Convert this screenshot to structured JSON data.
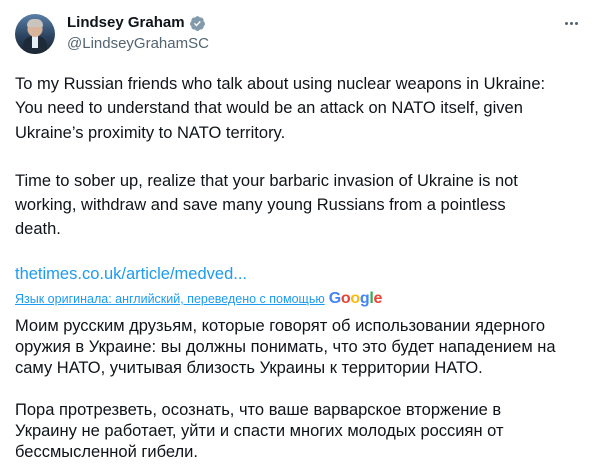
{
  "author": {
    "name": "Lindsey Graham",
    "handle": "@LindseyGrahamSC",
    "verified_color": "#1d9bf0"
  },
  "tweet": {
    "paragraphs": [
      "To my Russian friends who talk about using nuclear weapons in Ukraine:\nYou need to understand that would be an attack on NATO itself, given\nUkraine’s proximity to NATO territory.",
      "Time to sober up, realize that your barbaric invasion of Ukraine is not\nworking, withdraw and save many young Russians from a pointless\ndeath."
    ],
    "link": "thetimes.co.uk/article/medved..."
  },
  "translation": {
    "label": "Язык оригинала: английский, переведено с помощью",
    "provider": "Google",
    "paragraphs": [
      "Моим русским друзьям, которые говорят об использовании ядерного\nоружия в Украине: вы должны понимать, что это будет нападением на\nсаму НАТО, учитывая близость Украины к территории НАТО.",
      "Пора протрезветь, осознать, что ваше варварское вторжение в\nУкраину не работает, уйти и спасти многих молодых россиян от\nбессмысленной гибели."
    ]
  },
  "icons": {
    "verified": "verified-badge-icon",
    "more": "more-options-icon"
  },
  "colors": {
    "text": "#0f1419",
    "secondary": "#536471",
    "link": "#1d9bf0"
  }
}
